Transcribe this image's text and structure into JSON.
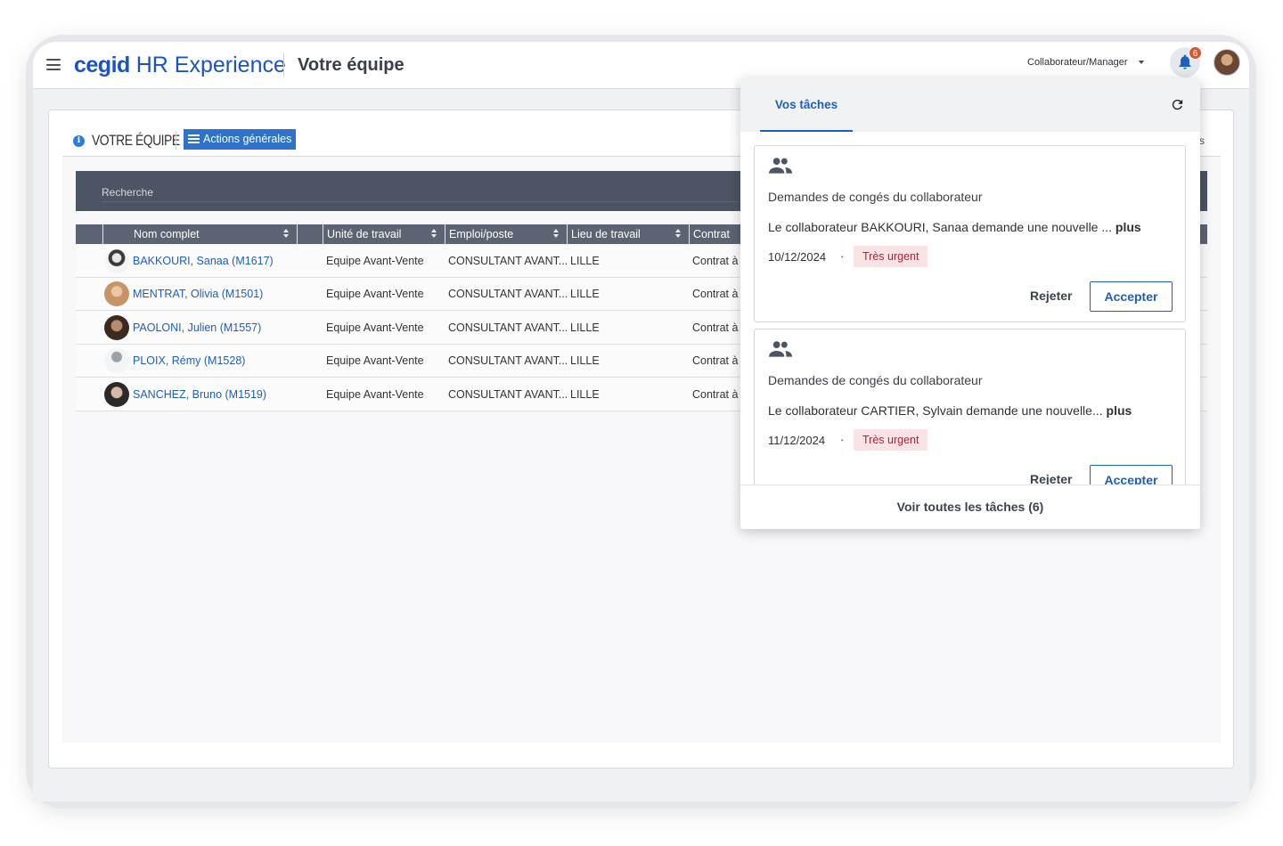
{
  "header": {
    "logo_brand": "cegid",
    "logo_product": "HR Experience",
    "page_title": "Votre équipe",
    "role": "Collaborateur/Manager",
    "notification_count": "6"
  },
  "panel": {
    "title": "VOTRE ÉQUIPE",
    "actions_label": "Actions générales",
    "right_fragment": "s",
    "search_placeholder": "Recherche"
  },
  "table": {
    "columns": [
      "Nom complet",
      "Unité de travail",
      "Emploi/poste",
      "Lieu de travail",
      "Contrat"
    ],
    "rows": [
      {
        "name": "BAKKOURI, Sanaa (M1617)",
        "unit": "Equipe Avant-Vente",
        "job": "CONSULTANT AVANT...",
        "place": "LILLE",
        "contract": "Contrat à"
      },
      {
        "name": "MENTRAT, Olivia (M1501)",
        "unit": "Equipe Avant-Vente",
        "job": "CONSULTANT AVANT...",
        "place": "LILLE",
        "contract": "Contrat à"
      },
      {
        "name": "PAOLONI, Julien (M1557)",
        "unit": "Equipe Avant-Vente",
        "job": "CONSULTANT AVANT...",
        "place": "LILLE",
        "contract": "Contrat à"
      },
      {
        "name": "PLOIX, Rémy (M1528)",
        "unit": "Equipe Avant-Vente",
        "job": "CONSULTANT AVANT...",
        "place": "LILLE",
        "contract": "Contrat à"
      },
      {
        "name": "SANCHEZ, Bruno (M1519)",
        "unit": "Equipe Avant-Vente",
        "job": "CONSULTANT AVANT...",
        "place": "LILLE",
        "contract": "Contrat à"
      }
    ]
  },
  "tasks": {
    "tab_label": "Vos tâches",
    "items": [
      {
        "title": "Demandes de congés du collaborateur",
        "desc": "Le collaborateur BAKKOURI, Sanaa demande une nouvelle ...",
        "more": "plus",
        "date": "10/12/2024",
        "separator": "·",
        "priority": "Très urgent",
        "reject": "Rejeter",
        "accept": "Accepter"
      },
      {
        "title": "Demandes de congés du collaborateur",
        "desc": "Le collaborateur CARTIER, Sylvain demande une nouvelle...",
        "more": "plus",
        "date": "11/12/2024",
        "separator": "·",
        "priority": "Très urgent",
        "reject": "Rejeter",
        "accept": "Accepter"
      }
    ],
    "footer_label": "Voir toutes les tâches (6)"
  },
  "colors": {
    "brand_blue": "#1b54c2",
    "link_blue": "#1d5fbf",
    "action_button": "#2f72c9",
    "header_dark": "#4b5563",
    "urgent_bg": "#fbe2e4",
    "urgent_text": "#b0242e",
    "badge": "#d8562c"
  }
}
